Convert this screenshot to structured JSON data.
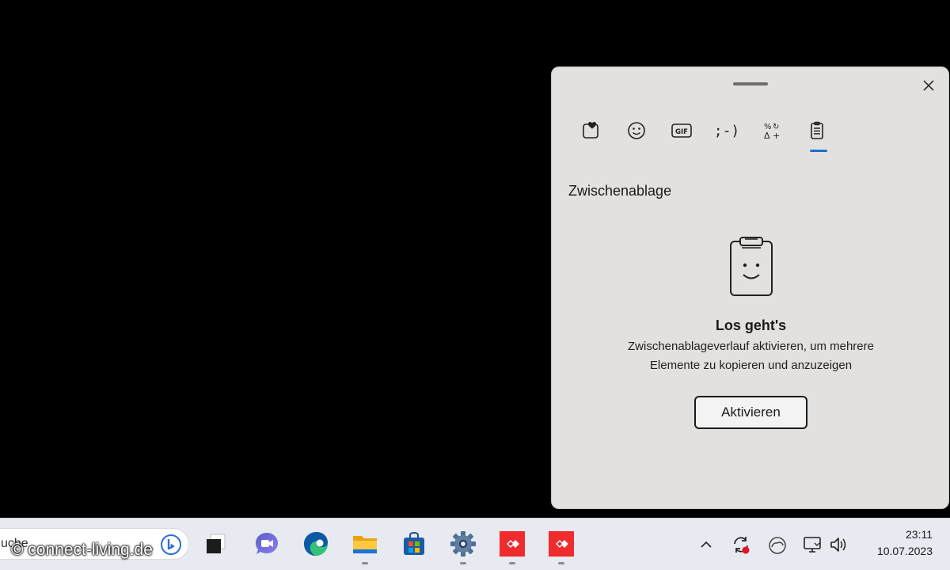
{
  "panel": {
    "tabs": [
      {
        "icon": "favorites-heart-icon",
        "label": ""
      },
      {
        "icon": "emoji-smiley-icon",
        "label": ""
      },
      {
        "icon": "gif-icon",
        "label": "GIF"
      },
      {
        "icon": "kaomoji-icon",
        "label": ";-)"
      },
      {
        "icon": "symbols-icon",
        "label": ""
      },
      {
        "icon": "clipboard-icon",
        "label": ""
      }
    ],
    "active_tab_index": 5,
    "section_title": "Zwischenablage",
    "empty_state": {
      "title": "Los geht's",
      "description": "Zwischenablageverlauf aktivieren, um mehrere Elemente zu kopieren und anzuzeigen",
      "button_label": "Aktivieren"
    }
  },
  "taskbar": {
    "search_text": "uche",
    "pinned_apps": [
      {
        "name": "task-view-icon",
        "running": false
      },
      {
        "name": "teams-chat-icon",
        "running": false
      },
      {
        "name": "edge-icon",
        "running": false
      },
      {
        "name": "file-explorer-icon",
        "running": true
      },
      {
        "name": "store-icon",
        "running": false
      },
      {
        "name": "settings-icon",
        "running": true
      },
      {
        "name": "anydesk-icon",
        "running": true
      },
      {
        "name": "anydesk-icon",
        "running": true
      }
    ],
    "tray": {
      "icons": [
        "chevron-up-icon",
        "sync-icon",
        "onedrive-icon",
        "network-icon",
        "volume-icon"
      ],
      "time": "23:11",
      "date": "10.07.2023"
    }
  },
  "watermark": "© connect-living.de",
  "colors": {
    "panel_bg": "#e3e1df",
    "accent": "#1f6fc9",
    "taskbar_bg": "#e7eaf0",
    "anydesk_red": "#ef2b2d"
  }
}
